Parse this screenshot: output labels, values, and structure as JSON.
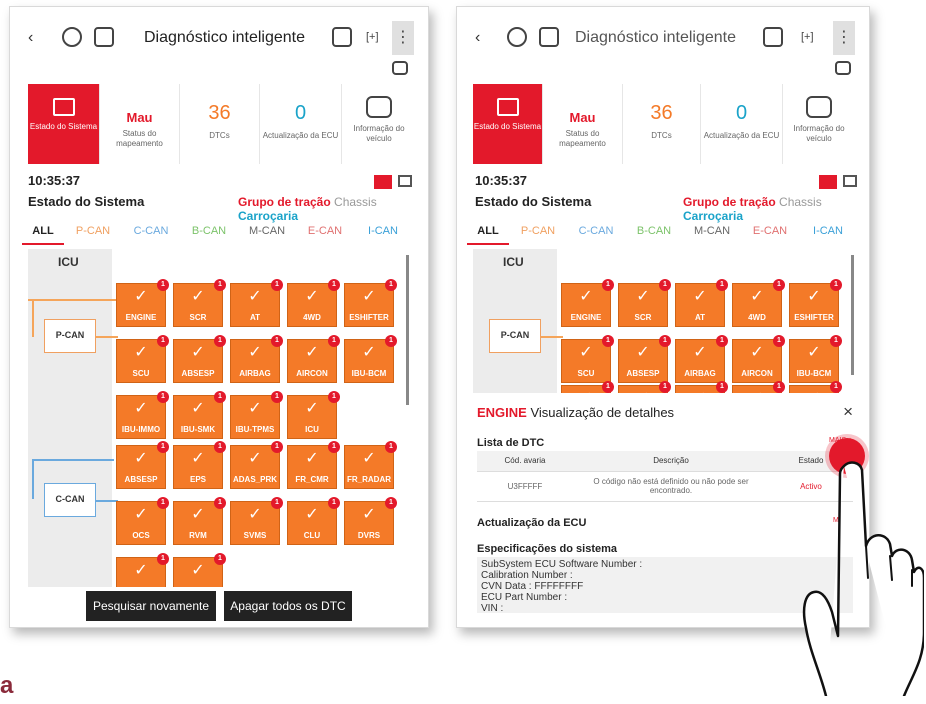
{
  "header": {
    "title": "Diagnóstico inteligente",
    "back_icon": "back-icon",
    "plus_label": "[+]",
    "menu_label": "⋮"
  },
  "summary": {
    "system_state_label": "Estado do Sistema",
    "mapping_value": "Mau",
    "mapping_label": "Status do mapeamento",
    "dtc_value": "36",
    "dtc_label": "DTCs",
    "ecu_update_value": "0",
    "ecu_update_label": "Actualização da ECU",
    "vehicle_info_label": "Informação do veículo"
  },
  "time": "10:35:37",
  "section_title": "Estado do Sistema",
  "groups": {
    "traction": "Grupo de tração",
    "chassis": "Chassis",
    "body": "Carroçaria"
  },
  "tabs": [
    "ALL",
    "P-CAN",
    "C-CAN",
    "B-CAN",
    "M-CAN",
    "E-CAN",
    "I-CAN"
  ],
  "tab_colors": [
    "#222222",
    "#f0a060",
    "#6aa9de",
    "#7cc36a",
    "#666666",
    "#e07070",
    "#3aa0d8"
  ],
  "diagram": {
    "icu_label": "ICU",
    "pcan_label": "P-CAN",
    "ccan_label": "C-CAN",
    "badge": "1",
    "check": "✓",
    "pcan_rows": [
      [
        "ENGINE",
        "SCR",
        "AT",
        "4WD",
        "ESHIFTER"
      ],
      [
        "SCU",
        "ABSESP",
        "AIRBAG",
        "AIRCON",
        "IBU-BCM"
      ],
      [
        "IBU-IMMO",
        "IBU-SMK",
        "IBU-TPMS",
        "ICU"
      ]
    ],
    "ccan_rows": [
      [
        "ABSESP",
        "EPS",
        "ADAS_PRK",
        "FR_CMR",
        "FR_RADAR"
      ],
      [
        "OCS",
        "RVM",
        "SVMS",
        "CLU",
        "DVRS"
      ],
      [
        "",
        ""
      ]
    ]
  },
  "buttons": {
    "search_again": "Pesquisar novamente",
    "clear_dtc": "Apagar todos os DTC"
  },
  "detail_panel": {
    "ecu_name": "ENGINE",
    "title_suffix": "Visualização de detalhes",
    "close": "×",
    "dtc_list_label": "Lista de DTC",
    "more_label": "MAIS +",
    "table_headers": [
      "Cód. avaria",
      "Descrição",
      "Estado"
    ],
    "table_rows": [
      [
        "U3FFFFF",
        "O código não está definido ou não pode ser encontrado.",
        "Activo"
      ]
    ],
    "ecu_update_label": "Actualização da ECU",
    "ecu_update_more": "M",
    "specs_label": "Especificações do sistema",
    "specs_lines": [
      "SubSystem ECU Software Number :",
      "Calibration Number :",
      "CVN Data : FFFFFFFF",
      "ECU Part Number :",
      "VIN :"
    ]
  },
  "corner_text": "a"
}
